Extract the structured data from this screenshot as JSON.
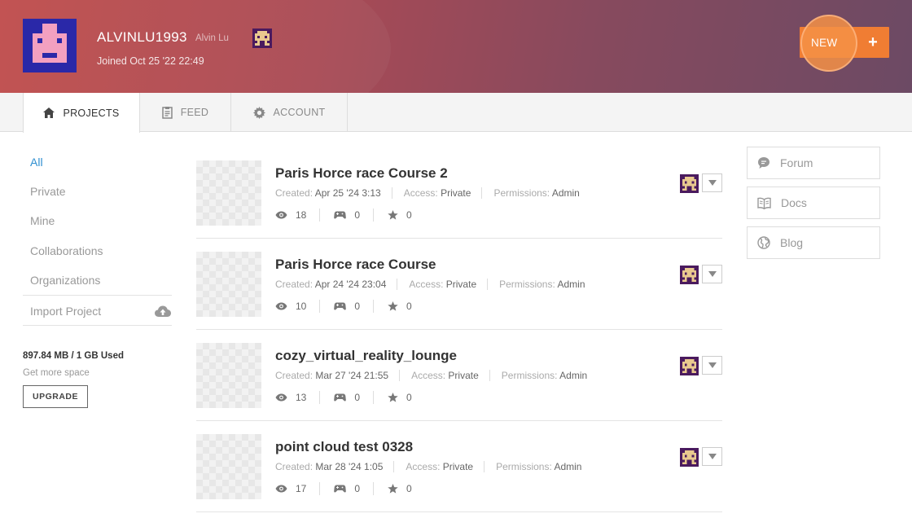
{
  "profile": {
    "username": "ALVINLU1993",
    "full_name": "Alvin Lu",
    "joined": "Joined Oct 25 '22 22:49"
  },
  "new_button": {
    "label": "NEW",
    "plus": "+"
  },
  "tabs": [
    {
      "label": "PROJECTS",
      "icon": "home-icon",
      "active": true
    },
    {
      "label": "FEED",
      "icon": "feed-icon",
      "active": false
    },
    {
      "label": "ACCOUNT",
      "icon": "gear-icon",
      "active": false
    }
  ],
  "sidebar": {
    "filters": [
      {
        "label": "All",
        "active": true
      },
      {
        "label": "Private",
        "active": false
      },
      {
        "label": "Mine",
        "active": false
      },
      {
        "label": "Collaborations",
        "active": false
      },
      {
        "label": "Organizations",
        "active": false
      }
    ],
    "import_label": "Import Project",
    "storage_used": "897.84 MB / 1 GB Used",
    "more_space": "Get more space",
    "upgrade_label": "UPGRADE"
  },
  "projects": [
    {
      "title": "Paris Horce race Course 2",
      "created_label": "Created:",
      "created": "Apr 25 '24 3:13",
      "access_label": "Access:",
      "access": "Private",
      "permissions_label": "Permissions:",
      "permissions": "Admin",
      "views": "18",
      "plays": "0",
      "stars": "0"
    },
    {
      "title": "Paris Horce race Course",
      "created_label": "Created:",
      "created": "Apr 24 '24 23:04",
      "access_label": "Access:",
      "access": "Private",
      "permissions_label": "Permissions:",
      "permissions": "Admin",
      "views": "10",
      "plays": "0",
      "stars": "0"
    },
    {
      "title": "cozy_virtual_reality_lounge",
      "created_label": "Created:",
      "created": "Mar 27 '24 21:55",
      "access_label": "Access:",
      "access": "Private",
      "permissions_label": "Permissions:",
      "permissions": "Admin",
      "views": "13",
      "plays": "0",
      "stars": "0"
    },
    {
      "title": "point cloud test 0328",
      "created_label": "Created:",
      "created": "Mar 28 '24 1:05",
      "access_label": "Access:",
      "access": "Private",
      "permissions_label": "Permissions:",
      "permissions": "Admin",
      "views": "17",
      "plays": "0",
      "stars": "0"
    }
  ],
  "links": [
    {
      "label": "Forum",
      "icon": "chat-bubble-icon"
    },
    {
      "label": "Docs",
      "icon": "book-icon"
    },
    {
      "label": "Blog",
      "icon": "globe-icon"
    }
  ],
  "colors": {
    "accent": "#f07d33",
    "link_active": "#2f8fd0",
    "avatar_blue": "#2a28a8",
    "avatar_pink": "#f3a0c0",
    "badge_purple": "#4a1a5e"
  }
}
